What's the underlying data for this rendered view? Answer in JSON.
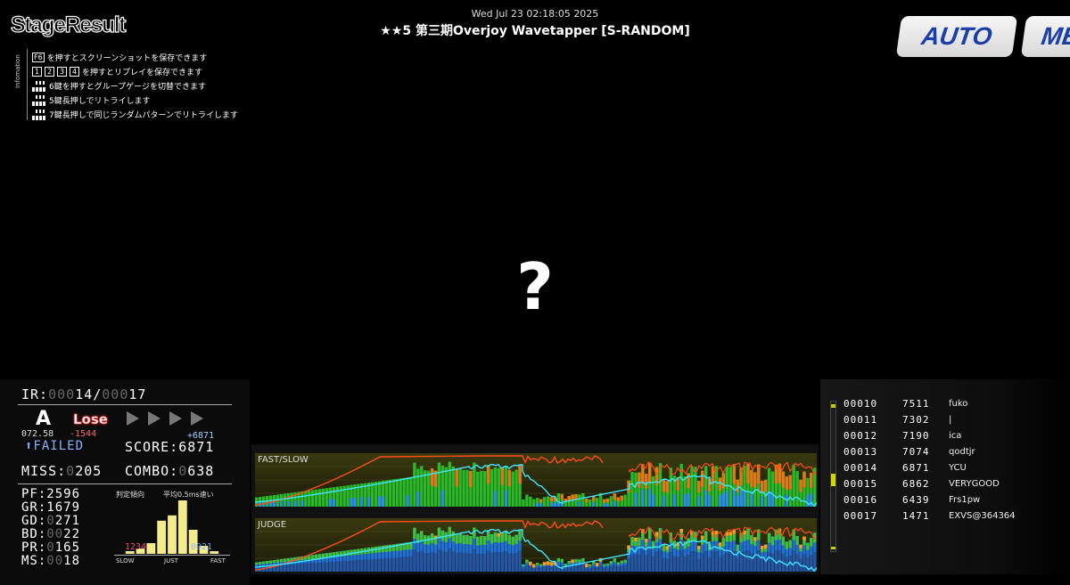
{
  "header": {
    "logo": "StageResult",
    "datetime": "Wed Jul 23 02:18:05 2025",
    "song_title": "★★5 第三期Overjoy Wavetapper [S-RANDOM]",
    "buttons": {
      "auto": "AUTO",
      "me": "ME"
    }
  },
  "info": {
    "tab_label": "Infomation",
    "rows": [
      {
        "keys": [
          "F6"
        ],
        "text": "を押すとスクリーンショットを保存できます"
      },
      {
        "keys": [
          "1",
          "2",
          "3",
          "4"
        ],
        "text": "を押すとリプレイを保存できます"
      },
      {
        "keys_icon": "keyboard-icon",
        "text": "6鍵を押すとグループゲージを切替できます"
      },
      {
        "keys_icon": "keyboard-icon",
        "text": "5鍵長押しでリトライします"
      },
      {
        "keys_icon": "keyboard-icon",
        "text": "7鍵長押しで同じランダムパターンでリトライします"
      }
    ]
  },
  "center": {
    "jacket_placeholder": "?"
  },
  "result": {
    "ir_label": "IR:",
    "ir_rank_dim": "000",
    "ir_rank": "14",
    "ir_sep": "/",
    "ir_total_dim": "000",
    "ir_total": "17",
    "rank": "A",
    "lose": "Lose",
    "rate": "072.58",
    "rate_diff": "-1544",
    "score_diff": "+6871",
    "failed": "FAILED",
    "score_label": "SCORE:",
    "score": "6871",
    "miss_label": "MISS:",
    "miss_dim": "0",
    "miss": "205",
    "combo_label": "COMBO:",
    "combo_dim": "0",
    "combo": "638",
    "judges": [
      {
        "label": "PF:",
        "dim": "",
        "value": "2596"
      },
      {
        "label": "GR:",
        "dim": "",
        "value": "1679"
      },
      {
        "label": "GD:",
        "dim": "0",
        "value": "271"
      },
      {
        "label": "BD:",
        "dim": "00",
        "value": "22"
      },
      {
        "label": "PR:",
        "dim": "0",
        "value": "165"
      },
      {
        "label": "MS:",
        "dim": "00",
        "value": "18"
      }
    ],
    "tendency_label": "判定傾向",
    "avg_label": "平均0.5ms速い",
    "slow_label": "SLOW",
    "just_label": "JUST",
    "fast_label": "FAST",
    "slow_count": "1234",
    "fast_count": "0921",
    "histogram": [
      0,
      0.05,
      0.1,
      0.2,
      0.62,
      0.72,
      1.0,
      0.45,
      0.15,
      0.05,
      0
    ],
    "colors": {
      "hist": "#f4eb8c",
      "failed": "#8ab0ff",
      "lose": "#e33333"
    }
  },
  "graphs": {
    "fast_slow_label": "FAST/SLOW",
    "judge_label": "JUDGE",
    "colors": {
      "gauge": "#ff4a1a",
      "bg_line": "#3ee5ff",
      "panel": "#2a2a00"
    }
  },
  "ranking": {
    "entries": [
      {
        "pos": "00010",
        "score": "7511",
        "name": "fuko"
      },
      {
        "pos": "00011",
        "score": "7302",
        "name": "|"
      },
      {
        "pos": "00012",
        "score": "7190",
        "name": "ica"
      },
      {
        "pos": "00013",
        "score": "7074",
        "name": "qodtjr"
      },
      {
        "pos": "00014",
        "score": "6871",
        "name": "YCU"
      },
      {
        "pos": "00015",
        "score": "6862",
        "name": "VERYGOOD"
      },
      {
        "pos": "00016",
        "score": "6439",
        "name": "Frs1pw"
      },
      {
        "pos": "00017",
        "score": "1471",
        "name": "EXVS@364364"
      }
    ]
  }
}
